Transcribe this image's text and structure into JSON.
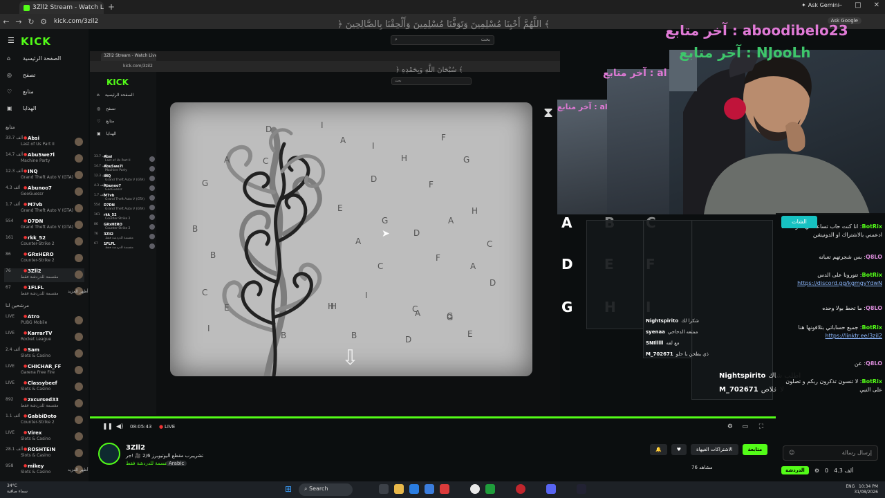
{
  "browser": {
    "tab_title": "3Zll2 Stream - Watch Live on K",
    "ask_gemini": "Ask Gemini",
    "url": "kick.com/3zil2",
    "ask_google": "Ask Google"
  },
  "sidebar": {
    "nav": [
      "الصفحة الرئيسية",
      "تصفح",
      "متابع",
      "الهدايا"
    ],
    "following_title": "متابع",
    "following": [
      {
        "name": "Absi",
        "count": "33.7 ألف",
        "game": "Last of Us Part II"
      },
      {
        "name": "AbuSwe7l",
        "count": "14.7 ألف",
        "game": "Machine Party"
      },
      {
        "name": "INQ",
        "count": "12.3 ألف",
        "game": "Grand Theft Auto V (GTA)"
      },
      {
        "name": "Abunoo7",
        "count": "4.3 ألف",
        "game": "GeoGuessr"
      },
      {
        "name": "M7vb",
        "count": "1.7 ألف",
        "game": "Grand Theft Auto V (GTA)"
      },
      {
        "name": "D7DN",
        "count": "554",
        "game": "Grand Theft Auto V (GTA)"
      },
      {
        "name": "rkk_52",
        "count": "161",
        "game": "Counter-Strike 2"
      },
      {
        "name": "GRxHERO",
        "count": "86",
        "game": "Counter-Strike 2"
      },
      {
        "name": "3Zll2",
        "count": "76",
        "game": "مقسمة للدردشة فقط"
      },
      {
        "name": "1FLFL",
        "count": "67",
        "game": "مقسمة للدردشة فقط"
      }
    ],
    "more1": "أظهر المزيد",
    "recommended_title": "مرشحين لنا",
    "recommended": [
      {
        "name": "Atro",
        "count": "LIVE",
        "game": "PUBG Mobile"
      },
      {
        "name": "KarrarTV",
        "count": "LIVE",
        "game": "Rocket League"
      },
      {
        "name": "Sam",
        "count": "2.4 ألف",
        "game": "Slots & Casino"
      },
      {
        "name": "CHICHAR_FF",
        "count": "LIVE",
        "game": "Garena Free Fire"
      },
      {
        "name": "Classybeef",
        "count": "LIVE",
        "game": "Slots & Casino"
      },
      {
        "name": "zxcursed33",
        "count": "892",
        "game": "مقسمة للدردشة فقط"
      },
      {
        "name": "GabbiDoto",
        "count": "1.1 ألف",
        "game": "Counter-Strike 2"
      },
      {
        "name": "Virex",
        "count": "LIVE",
        "game": "Slots & Casino"
      },
      {
        "name": "ROSHTEIN",
        "count": "28.1 ألف",
        "game": "Slots & Casino"
      },
      {
        "name": "mikey",
        "count": "958",
        "game": "Slots & Casino"
      }
    ],
    "more2": "أظهر المزيد"
  },
  "search": {
    "placeholder": "بحث"
  },
  "overlay_text": {
    "dua1": "﴿ اللَّهُمَّ أَحْيِنَا مُسْلِمِينَ وَتَوَفَّنَا مُسْلِمِينَ وَأَلْحِقْنَا بِالصَّالِحِينَ ﴾",
    "dua2": "﴿ سُبْحَانَ اللَّهِ وَبِحَمْدِهِ ﴾",
    "last_follower_1": "آخر متابع : aboodibelo23",
    "last_follower_2": "آخر متابع : NJooLh",
    "last_follower_3": "آخر متابع : al",
    "last_follower_4": "آخر متابع : al"
  },
  "game": {
    "letters": [
      "D",
      "I",
      "A",
      "I",
      "F",
      "A",
      "C",
      "H",
      "G",
      "G",
      "D",
      "F",
      "E",
      "H",
      "G",
      "B",
      "A",
      "D",
      "A",
      "B",
      "C",
      "C",
      "F",
      "A",
      "D",
      "C",
      "I",
      "E",
      "H",
      "C",
      "G",
      "I",
      "A",
      "G",
      "H",
      "B",
      "D",
      "E",
      "B"
    ],
    "side_letters": [
      "A",
      "B",
      "C",
      "D",
      "E",
      "F",
      "G",
      "H",
      "I"
    ]
  },
  "chat": {
    "tab_label": "الشات",
    "messages": [
      {
        "user": "BotRix",
        "text": "انا كنت حاب تساعد في نمو القناة ادعمني بالاشتراك او الدونيشن"
      },
      {
        "user": "Q8LO",
        "text": "بس شجرتهم تعبانه"
      },
      {
        "user": "BotRix",
        "text": "تنورونا على الدس",
        "link": "https://discord.gg/kgmgyYdwN"
      },
      {
        "user": "Q8LO",
        "text": "ما تحط بولا وحده"
      },
      {
        "user": "BotRix",
        "text": "جميع حساباتي بتلاقونها هنا",
        "link": "https://linktr.ee/3zil2"
      },
      {
        "user": "Q8LO",
        "text": "عن"
      },
      {
        "user": "BotRix",
        "text": "لا تنسون تذكرون ربكم و تصلون على النبي"
      }
    ],
    "input_placeholder": "إرسال رسالة",
    "count": "4.3 ألف",
    "zero": "0",
    "send": "الدردشة"
  },
  "overlay_chat": [
    {
      "user": "Nightspirito",
      "text": "شكرا لك"
    },
    {
      "user": "syenaa",
      "text": "ممتعه الدحاحي"
    },
    {
      "user": "SNIlllll",
      "text": "مع لفه"
    },
    {
      "user": "M_702671",
      "text": "ذي يطحن يا حلو"
    }
  ],
  "overlay_chat_big": [
    {
      "user": "Nightspirito",
      "text": "اطلب شاك"
    },
    {
      "user": "M_702671",
      "text": "لا خلاص"
    }
  ],
  "player": {
    "time": "08:05:43",
    "live": "LIVE"
  },
  "streamer": {
    "name": "3Zll2",
    "title": "تشريبرب مقطع اليوتيوبرز 2/6 🎥 !جر",
    "category": "مقسمة للدردشة فقط",
    "tag": "Arabic",
    "follow": "متابعة",
    "subscribe": "الاشتراكات الغيهاة",
    "viewers": "76 مشاهد"
  },
  "taskbar": {
    "temp": "34°C",
    "weather": "سماء صافية",
    "search": "Search",
    "time": "10:34 PM",
    "date": "31/08/2026",
    "lang": "ENG"
  },
  "colors": {
    "kick_green": "#53fc18",
    "chat_tab": "#17c2c2",
    "follower_pink": "#e07ad6",
    "follower_green": "#3ec66b"
  }
}
